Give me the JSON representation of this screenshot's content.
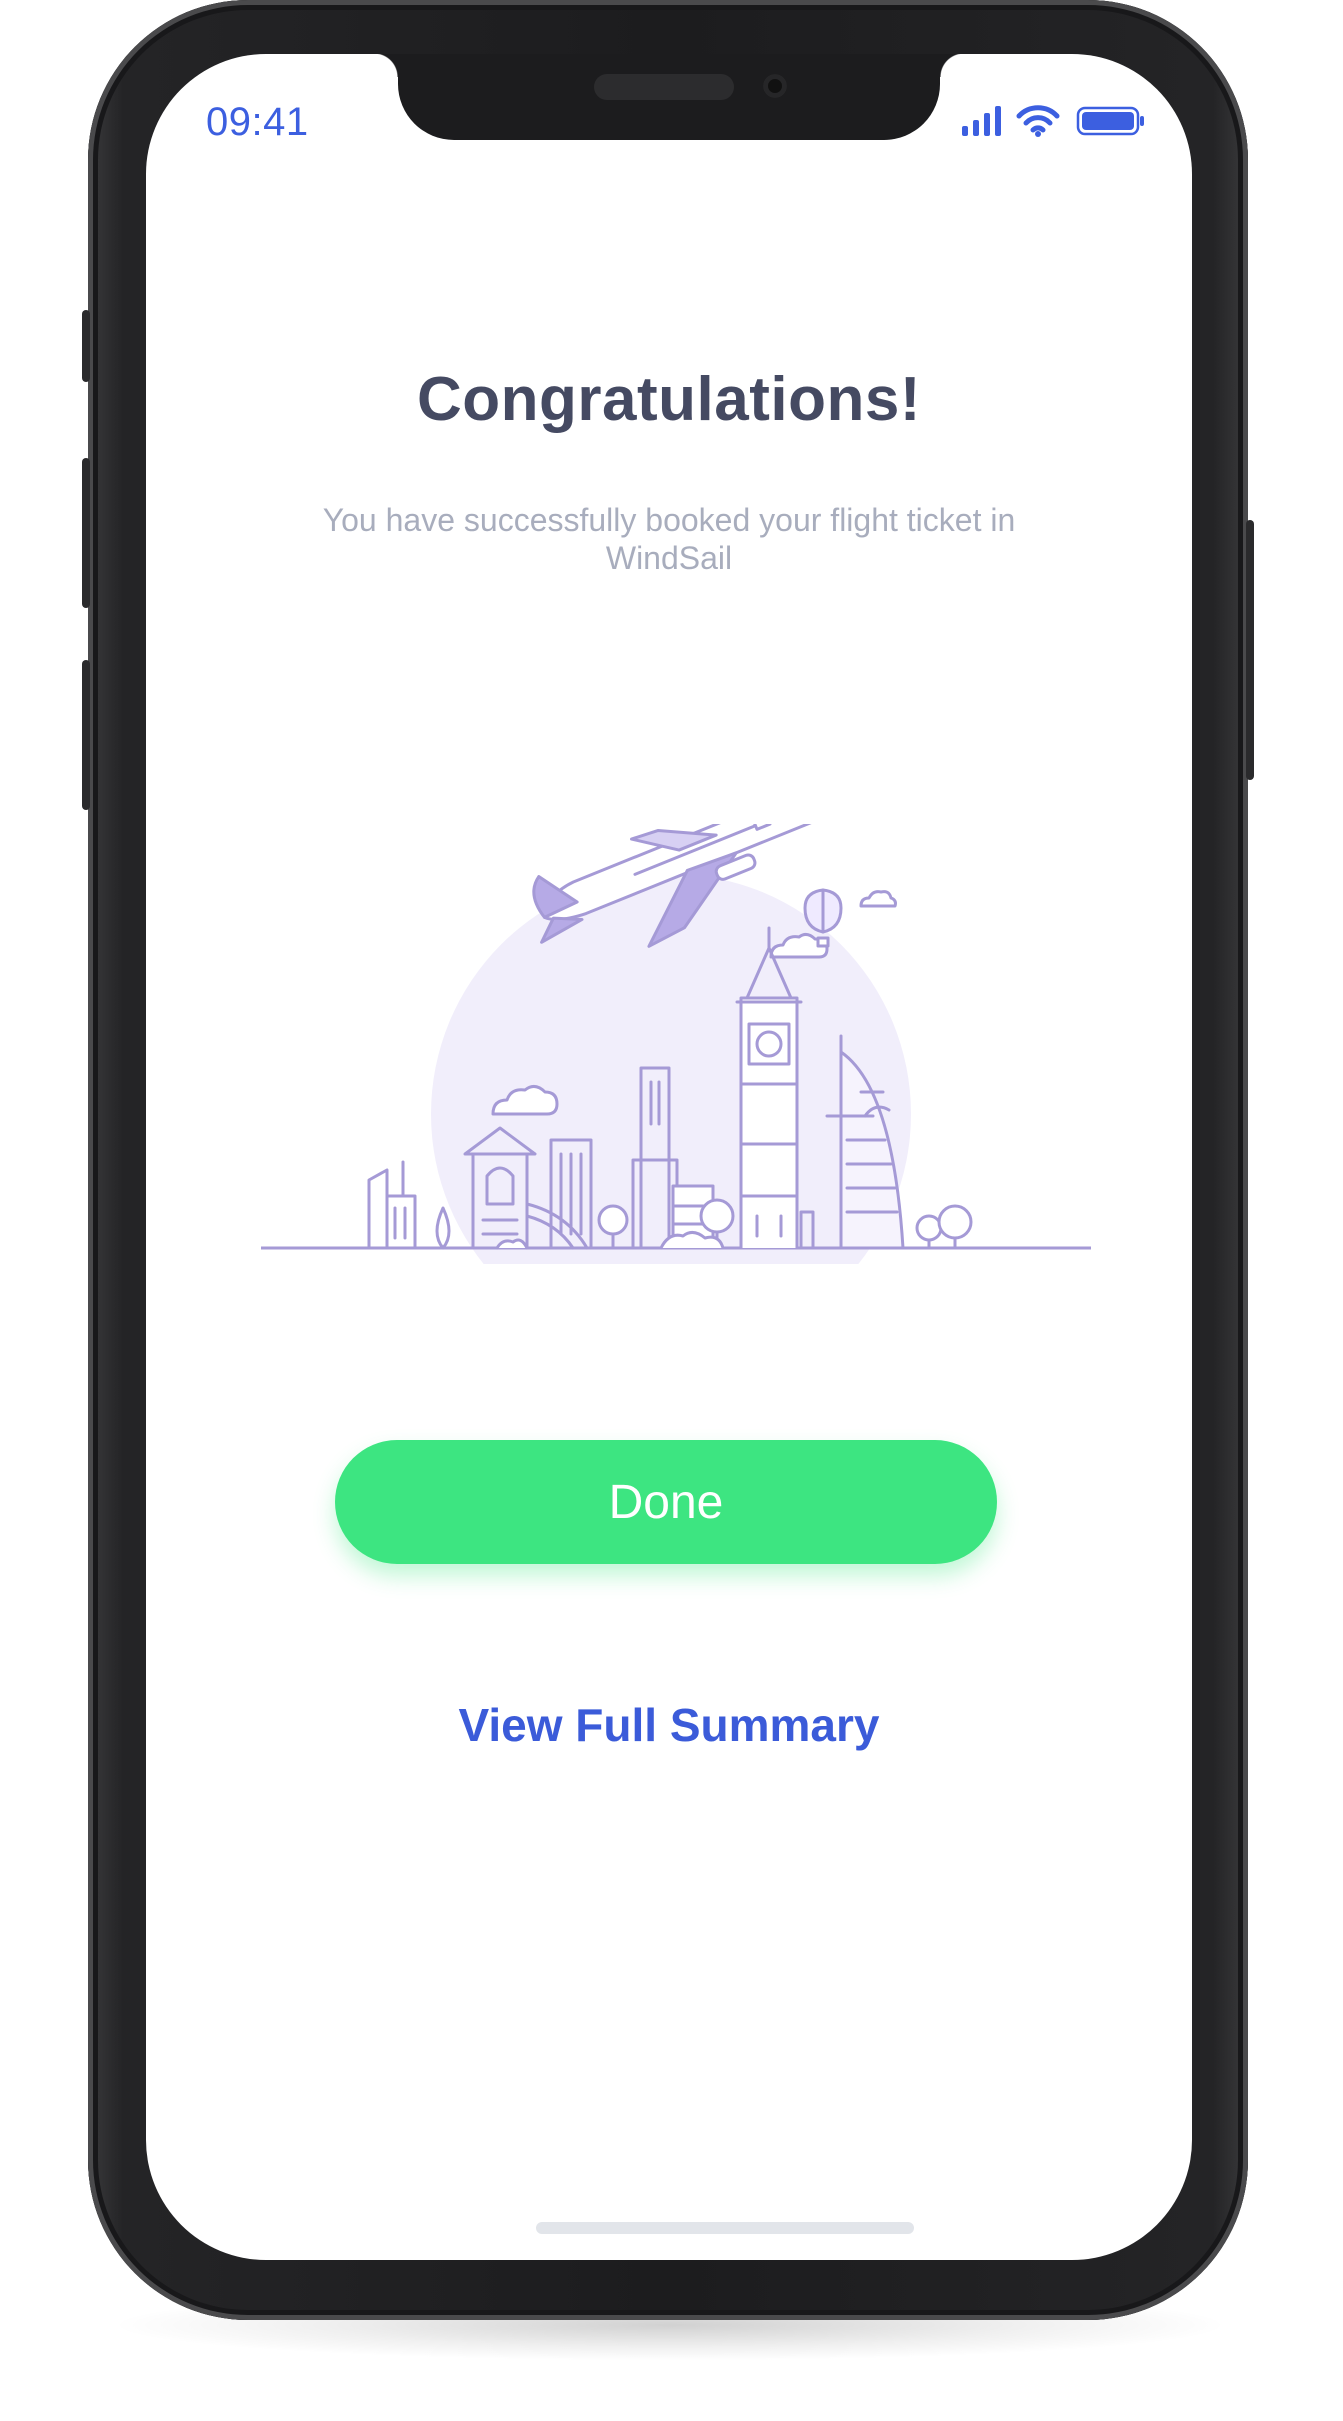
{
  "status_bar": {
    "time": "09:41",
    "icons": [
      "cellular-signal-icon",
      "wifi-icon",
      "battery-icon"
    ]
  },
  "confirmation": {
    "title": "Congratulations!",
    "message": "You have successfully booked your flight ticket in WindSail"
  },
  "illustration": {
    "name": "airplane-over-city-illustration"
  },
  "actions": {
    "done_label": "Done",
    "summary_label": "View Full Summary"
  },
  "colors": {
    "accent_green": "#3de581",
    "link_blue": "#3b5bd9",
    "status_blue": "#3c5fe0",
    "title_text": "#454a62",
    "subtitle_text": "#a8adbd",
    "illustration_purple": "#a59ad6"
  }
}
